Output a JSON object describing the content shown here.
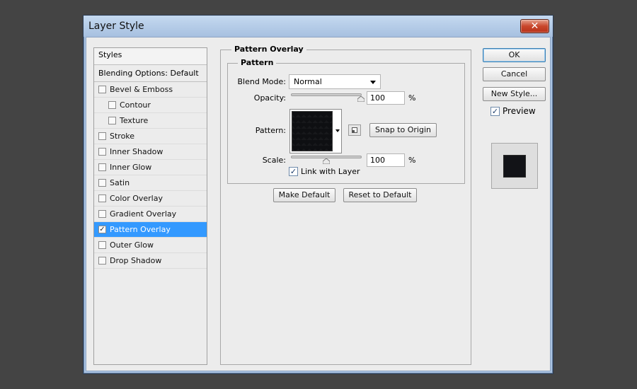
{
  "window": {
    "title": "Layer Style",
    "close_glyph": "✕"
  },
  "styles_panel": {
    "header": "Styles",
    "blending_options": "Blending Options: Default",
    "items": [
      {
        "label": "Bevel & Emboss",
        "checked": false,
        "sub": false
      },
      {
        "label": "Contour",
        "checked": false,
        "sub": true
      },
      {
        "label": "Texture",
        "checked": false,
        "sub": true
      },
      {
        "label": "Stroke",
        "checked": false,
        "sub": false
      },
      {
        "label": "Inner Shadow",
        "checked": false,
        "sub": false
      },
      {
        "label": "Inner Glow",
        "checked": false,
        "sub": false
      },
      {
        "label": "Satin",
        "checked": false,
        "sub": false
      },
      {
        "label": "Color Overlay",
        "checked": false,
        "sub": false
      },
      {
        "label": "Gradient Overlay",
        "checked": false,
        "sub": false
      },
      {
        "label": "Pattern Overlay",
        "checked": true,
        "sub": false,
        "active": true
      },
      {
        "label": "Outer Glow",
        "checked": false,
        "sub": false
      },
      {
        "label": "Drop Shadow",
        "checked": false,
        "sub": false
      }
    ]
  },
  "pattern_overlay": {
    "group_title": "Pattern Overlay",
    "subgroup_title": "Pattern",
    "blend_mode_label": "Blend Mode:",
    "blend_mode_value": "Normal",
    "opacity_label": "Opacity:",
    "opacity_value": "100",
    "opacity_unit": "%",
    "opacity_fraction": 1.0,
    "pattern_label": "Pattern:",
    "snap_to_origin": "Snap to Origin",
    "scale_label": "Scale:",
    "scale_value": "100",
    "scale_unit": "%",
    "scale_fraction": 0.5,
    "link_with_layer": "Link with Layer",
    "link_checked": true,
    "make_default": "Make Default",
    "reset_to_default": "Reset to Default"
  },
  "right_buttons": {
    "ok": "OK",
    "cancel": "Cancel",
    "new_style": "New Style...",
    "preview_label": "Preview",
    "preview_checked": true
  },
  "colors": {
    "active_item": "#3399ff",
    "pattern_swatch": "#0e0f12",
    "titlebar": "#a9c3e3"
  }
}
